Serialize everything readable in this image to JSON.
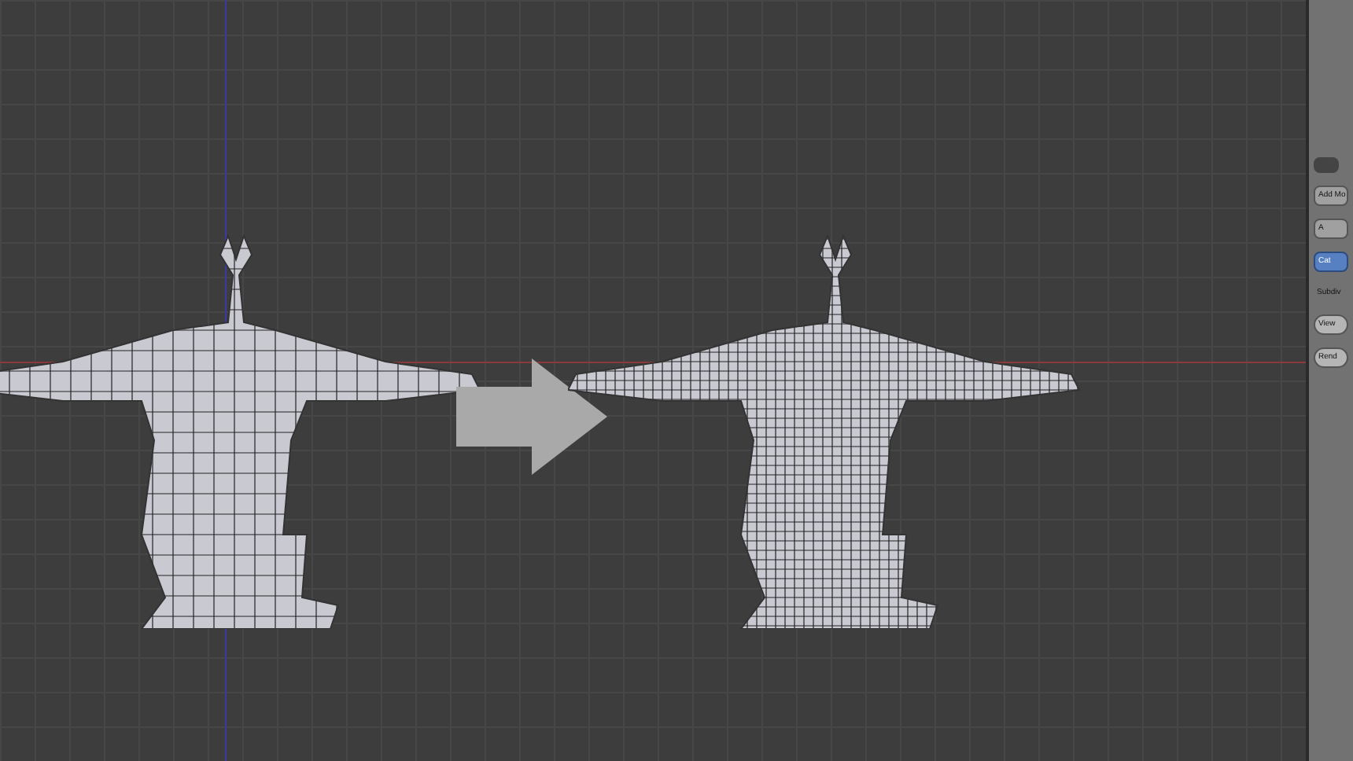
{
  "viewport": {
    "models": [
      {
        "kind": "low-poly"
      },
      {
        "kind": "high-poly"
      }
    ]
  },
  "properties_panel": {
    "buttons": [
      {
        "label": "Add Mo",
        "kind": "plain",
        "selected": false
      },
      {
        "label": "A",
        "kind": "plain",
        "selected": false
      },
      {
        "label": "Cat",
        "kind": "plain",
        "selected": true
      },
      {
        "label": "Subdiv",
        "kind": "text",
        "selected": false
      },
      {
        "label": "View",
        "kind": "round",
        "selected": false
      },
      {
        "label": "Rend",
        "kind": "round",
        "selected": false
      }
    ]
  }
}
